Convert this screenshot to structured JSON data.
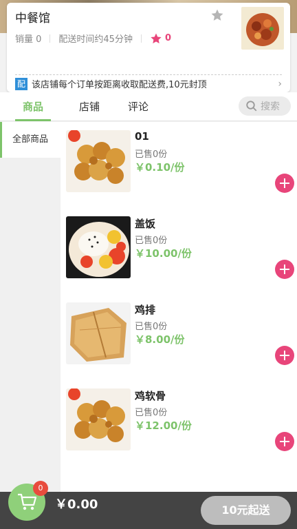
{
  "shop": {
    "name": "中餐馆",
    "sales": "销量 0",
    "delivery_time": "配送时间约45分钟",
    "rating": "0",
    "notice_tag": "配",
    "notice": "该店铺每个订单按距离收取配送费,10元封顶"
  },
  "tabs": [
    {
      "label": "商品",
      "active": true
    },
    {
      "label": "店铺",
      "active": false
    },
    {
      "label": "评论",
      "active": false
    }
  ],
  "search": {
    "placeholder": "搜索"
  },
  "categories": [
    {
      "label": "全部商品",
      "active": true
    }
  ],
  "products": [
    {
      "name": "01",
      "sold": "已售0份",
      "price": "￥0.10/份",
      "image": "fried-chicken"
    },
    {
      "name": "盖饭",
      "sold": "已售0份",
      "price": "￥10.00/份",
      "image": "rice-bowl"
    },
    {
      "name": "鸡排",
      "sold": "已售0份",
      "price": "￥8.00/份",
      "image": "chicken-cutlet"
    },
    {
      "name": "鸡软骨",
      "sold": "已售0份",
      "price": "￥12.00/份",
      "image": "fried-chicken"
    }
  ],
  "cart": {
    "count": "0",
    "total": "￥0.00",
    "checkout_label": "10元起送"
  },
  "colors": {
    "accent": "#7dc36a",
    "pink": "#e8457a",
    "bar": "#444444"
  }
}
